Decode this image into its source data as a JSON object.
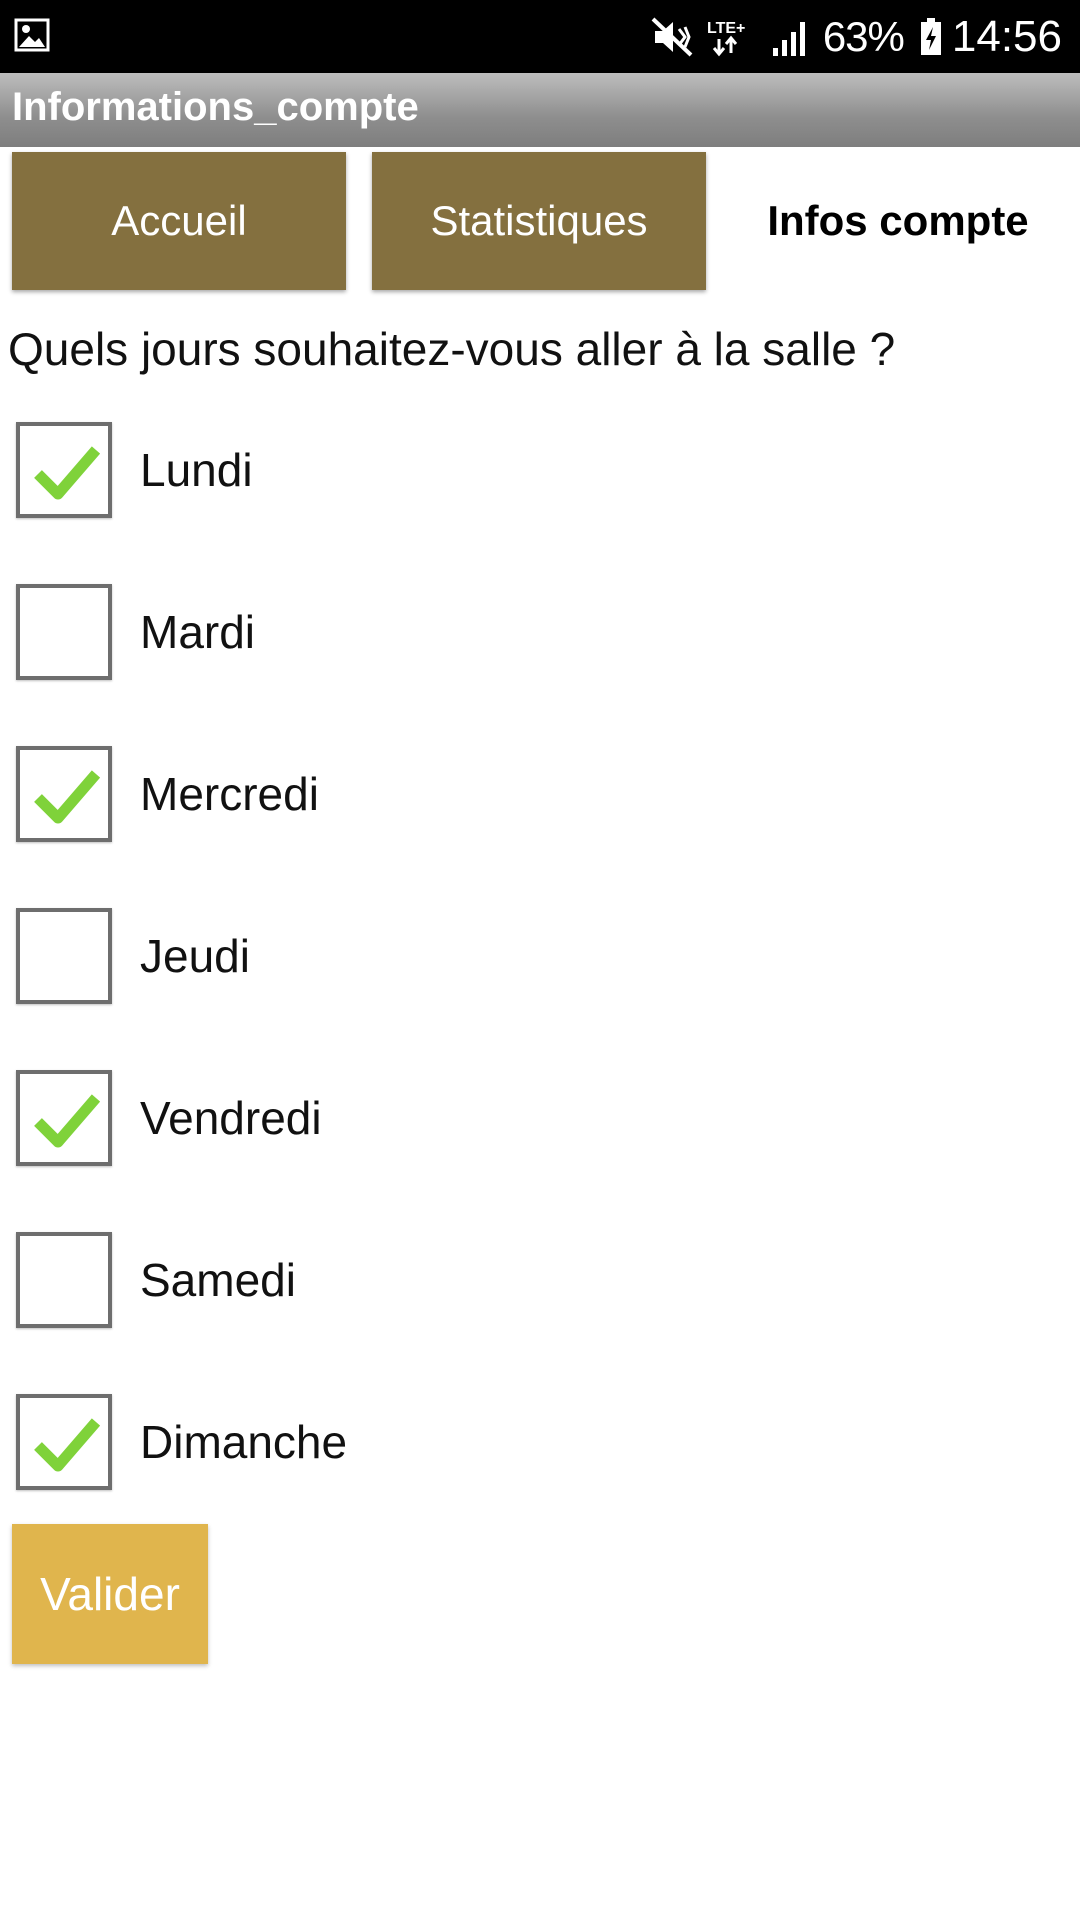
{
  "status_bar": {
    "gallery_icon": "image-icon",
    "battery_text": "63%",
    "time": "14:56",
    "network": "LTE+"
  },
  "app": {
    "title": "Informations_compte"
  },
  "tabs": [
    {
      "label": "Accueil",
      "active": false
    },
    {
      "label": "Statistiques",
      "active": false
    },
    {
      "label": "Infos compte",
      "active": true
    }
  ],
  "question": "Quels jours souhaitez-vous aller à la salle ?",
  "days": [
    {
      "label": "Lundi",
      "checked": true
    },
    {
      "label": "Mardi",
      "checked": false
    },
    {
      "label": "Mercredi",
      "checked": true
    },
    {
      "label": "Jeudi",
      "checked": false
    },
    {
      "label": "Vendredi",
      "checked": true
    },
    {
      "label": "Samedi",
      "checked": false
    },
    {
      "label": "Dimanche",
      "checked": true
    }
  ],
  "submit_label": "Valider",
  "colors": {
    "tab_bg": "#84703f",
    "submit_bg": "#e0b54d",
    "check": "#7fd23a"
  }
}
